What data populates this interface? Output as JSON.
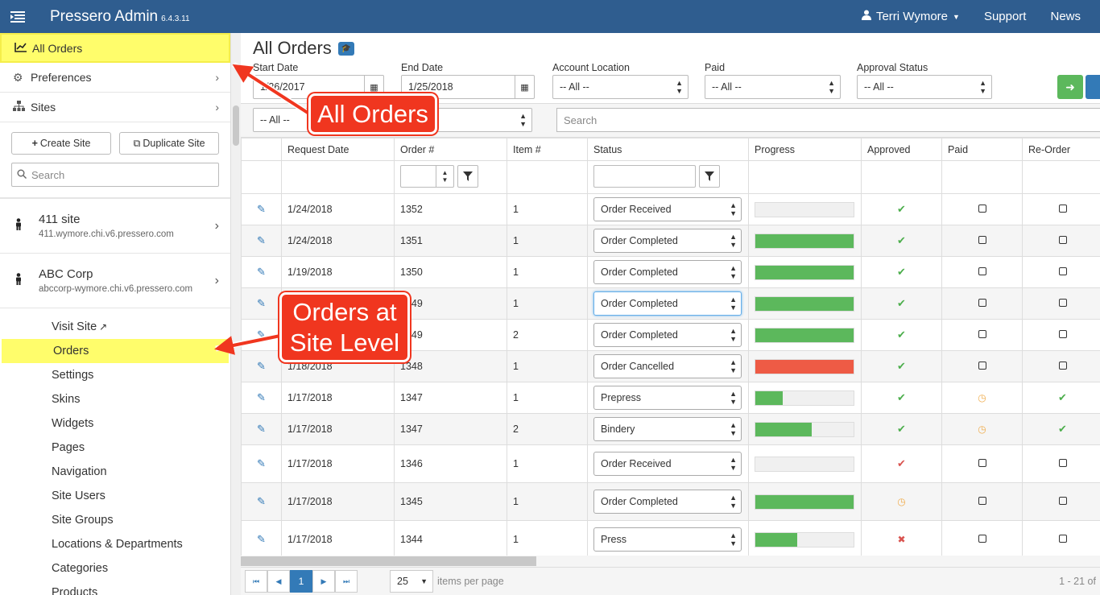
{
  "topbar": {
    "brand": "Pressero Admin",
    "version": "6.4.3.11",
    "user": "Terri Wymore",
    "support": "Support",
    "news": "News"
  },
  "sidebar": {
    "nav": [
      {
        "label": "All Orders",
        "icon": "chart-line-icon",
        "active": true
      },
      {
        "label": "Preferences",
        "icon": "gears-icon"
      },
      {
        "label": "Sites",
        "icon": "sitemap-icon"
      }
    ],
    "create_site": "Create Site",
    "duplicate_site": "Duplicate Site",
    "search_placeholder": "Search",
    "sites": [
      {
        "name": "411 site",
        "url": "411.wymore.chi.v6.pressero.com"
      },
      {
        "name": "ABC Corp",
        "url": "abccorp-wymore.chi.v6.pressero.com"
      }
    ],
    "links": [
      "Visit Site",
      "Orders",
      "Settings",
      "Skins",
      "Widgets",
      "Pages",
      "Navigation",
      "Site Users",
      "Site Groups",
      "Locations & Departments",
      "Categories",
      "Products"
    ]
  },
  "main": {
    "title": "All Orders",
    "filters": {
      "start_label": "Start Date",
      "start_value": "1/26/2017",
      "end_label": "End Date",
      "end_value": "1/25/2018",
      "location_label": "Account Location",
      "location_value": "-- All --",
      "paid_label": "Paid",
      "paid_value": "-- All --",
      "approval_label": "Approval Status",
      "approval_value": "-- All --",
      "second_value": "-- All --",
      "search_placeholder": "Search"
    },
    "columns": [
      "Request Date",
      "Order #",
      "Item #",
      "Status",
      "Progress",
      "Approved",
      "Paid",
      "Re-Order"
    ],
    "rows": [
      {
        "date": "1/24/2018",
        "order": "1352",
        "item": "1",
        "status": "Order Received",
        "progress": 0,
        "approved": "check",
        "paid": "box",
        "reorder": "box"
      },
      {
        "date": "1/24/2018",
        "order": "1351",
        "item": "1",
        "status": "Order Completed",
        "progress": 100,
        "approved": "check",
        "paid": "box",
        "reorder": "box"
      },
      {
        "date": "1/19/2018",
        "order": "1350",
        "item": "1",
        "status": "Order Completed",
        "progress": 100,
        "approved": "check",
        "paid": "box",
        "reorder": "box"
      },
      {
        "date": "",
        "order": "1349",
        "item": "1",
        "status": "Order Completed",
        "progress": 100,
        "approved": "check",
        "paid": "box",
        "reorder": "box"
      },
      {
        "date": "",
        "order": "1349",
        "item": "2",
        "status": "Order Completed",
        "progress": 100,
        "approved": "check",
        "paid": "box",
        "reorder": "box"
      },
      {
        "date": "1/18/2018",
        "order": "1348",
        "item": "1",
        "status": "Order Cancelled",
        "progress": 100,
        "approved": "check",
        "paid": "box",
        "reorder": "box"
      },
      {
        "date": "1/17/2018",
        "order": "1347",
        "item": "1",
        "status": "Prepress",
        "progress": 28,
        "approved": "check",
        "paid": "clock",
        "reorder": "check"
      },
      {
        "date": "1/17/2018",
        "order": "1347",
        "item": "2",
        "status": "Bindery",
        "progress": 57,
        "approved": "check",
        "paid": "clock",
        "reorder": "check"
      },
      {
        "date": "1/17/2018",
        "order": "1346",
        "item": "1",
        "status": "Order Received",
        "progress": 0,
        "approved": "check-red",
        "paid": "box",
        "reorder": "box"
      },
      {
        "date": "1/17/2018",
        "order": "1345",
        "item": "1",
        "status": "Order Completed",
        "progress": 100,
        "approved": "clock",
        "paid": "box",
        "reorder": "box"
      },
      {
        "date": "1/17/2018",
        "order": "1344",
        "item": "1",
        "status": "Press",
        "progress": 43,
        "approved": "x",
        "paid": "box",
        "reorder": "box"
      }
    ],
    "pager": {
      "page": "1",
      "per_page": "25",
      "per_page_label": "items per page",
      "range": "1 - 21 of"
    }
  },
  "annotations": {
    "all_orders": "All Orders",
    "site_orders_line1": "Orders at",
    "site_orders_line2": "Site Level"
  },
  "colors": {
    "topbar": "#2f5d8f",
    "highlight": "#fffd6b",
    "callout": "#f0361f",
    "progress": "#5cb85c",
    "cancel": "#ee5b45"
  }
}
